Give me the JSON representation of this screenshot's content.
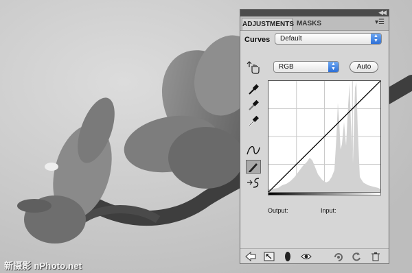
{
  "watermark": "新摄影 nPhoto.net",
  "panel": {
    "tabs": [
      {
        "label": "ADJUSTMENTS",
        "active": true
      },
      {
        "label": "MASKS",
        "active": false
      }
    ],
    "collapse_icon": "double-chevron-right-icon",
    "menu_icon": "panel-menu-icon",
    "curves_label": "Curves",
    "preset": {
      "selected": "Default"
    },
    "channel": {
      "selected": "RGB"
    },
    "auto_label": "Auto",
    "tools": [
      "on-image-adjust-icon",
      "black-eyedropper-icon",
      "gray-eyedropper-icon",
      "white-eyedropper-icon",
      "curve-point-icon",
      "pencil-draw-icon",
      "smooth-curve-icon"
    ],
    "output_label": "Output:",
    "input_label": "Input:",
    "footer_icons": [
      "back-arrow-icon",
      "expand-view-icon",
      "clip-layer-icon",
      "visibility-eye-icon",
      "previous-state-icon",
      "reset-icon",
      "trash-icon"
    ]
  },
  "colors": {
    "panel_bg": "#d6d6d6",
    "select_accent": "#2d6fd6",
    "histogram": "#d2d2d2"
  }
}
